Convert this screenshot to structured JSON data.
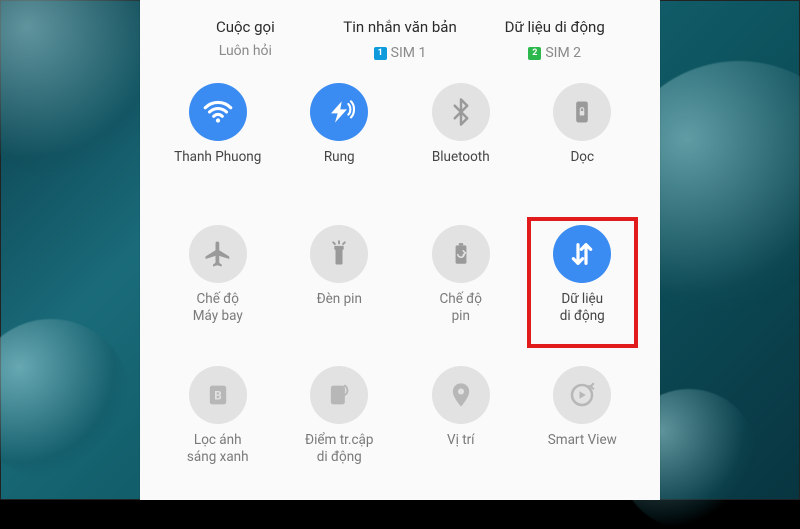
{
  "sim_headers": [
    {
      "title": "Cuộc gọi",
      "sub": "Luôn hỏi",
      "badge": null
    },
    {
      "title": "Tin nhắn văn bản",
      "sub": "SIM 1",
      "badge": "1",
      "badge_class": "b1"
    },
    {
      "title": "Dữ liệu di động",
      "sub": "SIM 2",
      "badge": "2",
      "badge_class": "b2"
    }
  ],
  "tiles": {
    "wifi": {
      "label": "Thanh Phuong"
    },
    "vibrate": {
      "label": "Rung"
    },
    "bluetooth": {
      "label": "Bluetooth"
    },
    "portrait": {
      "label": "Dọc"
    },
    "airplane": {
      "label": "Chế độ\nMáy bay"
    },
    "flashlight": {
      "label": "Đèn pin"
    },
    "battery": {
      "label": "Chế độ\npin"
    },
    "mobiledata": {
      "label": "Dữ liệu\ndi động"
    },
    "bluelight": {
      "label": "Lọc ánh\nsáng xanh"
    },
    "hotspot": {
      "label": "Điểm tr.cập\ndi động"
    },
    "location": {
      "label": "Vị trí"
    },
    "smartview": {
      "label": "Smart View"
    }
  },
  "colors": {
    "active": "#3b8cf2",
    "inactive": "#e2e2e2",
    "highlight": "#e11b1b"
  }
}
